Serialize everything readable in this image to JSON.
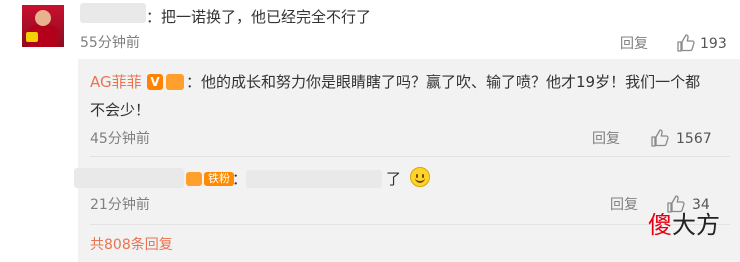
{
  "top_comment": {
    "text": "：把一诺换了，他已经完全不行了",
    "time": "55分钟前",
    "reply_label": "回复",
    "like_count": "193"
  },
  "replies": [
    {
      "username": "AG菲菲",
      "badge_letter": "V",
      "text_line1": "：他的成长和努力你是眼睛瞎了吗？赢了吹、输了喷？他才19岁！我们一个都",
      "text_line2": "不会少！",
      "time": "45分钟前",
      "reply_label": "回复",
      "like_count": "1567"
    },
    {
      "fan_badge": "铁粉",
      "text": "：",
      "text_end": "了",
      "time": "21分钟前",
      "reply_label": "回复",
      "like_count": "34"
    }
  ],
  "more_replies": "共808条回复",
  "watermark": {
    "hl": "傻",
    "rest": "大方"
  },
  "colors": {
    "accent": "#eb7350",
    "reply_bg": "#f2f2f2",
    "badge_orange": "#ff8200"
  }
}
